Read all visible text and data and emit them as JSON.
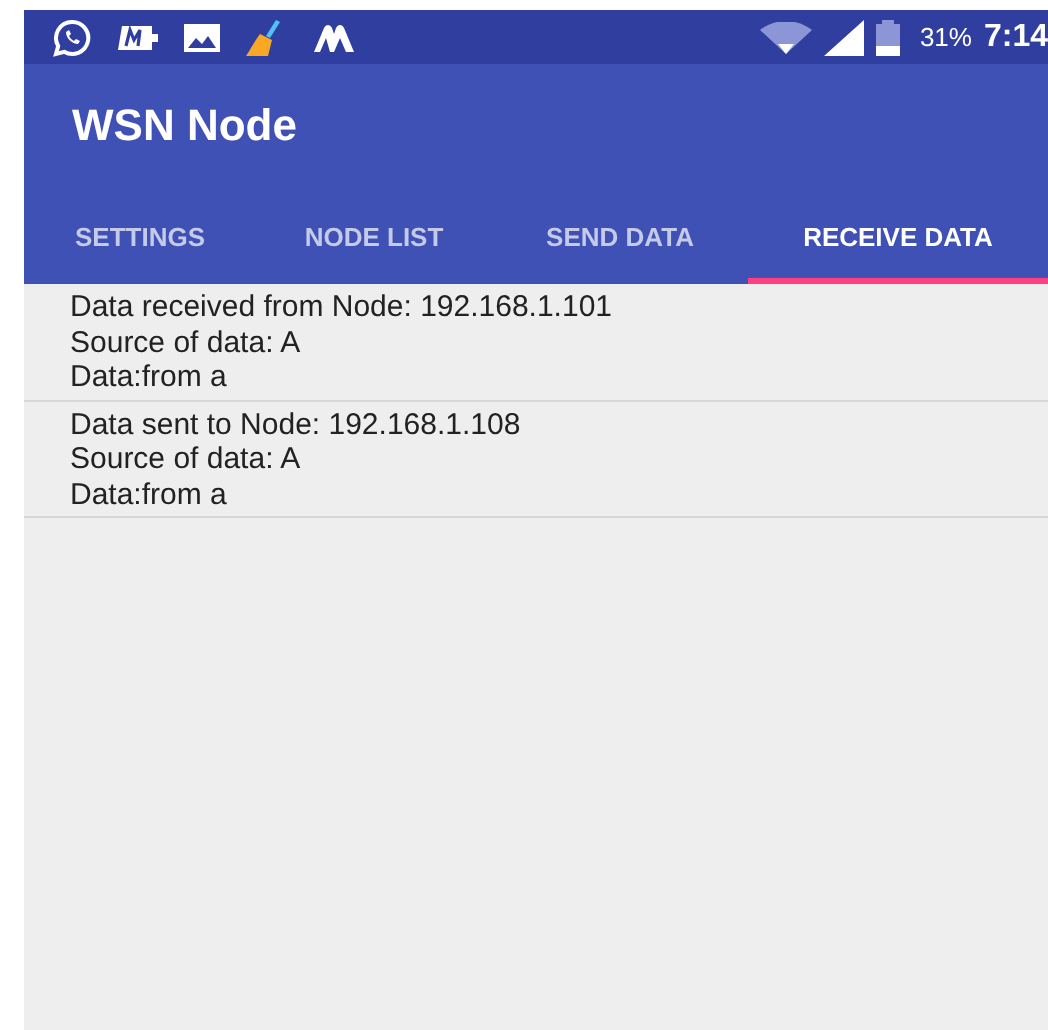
{
  "status_bar": {
    "battery": "31%",
    "time": "7:14"
  },
  "app_bar": {
    "title": "WSN Node"
  },
  "tabs": [
    {
      "label": "SETTINGS",
      "selected": false
    },
    {
      "label": "NODE LIST",
      "selected": false
    },
    {
      "label": "SEND DATA",
      "selected": false
    },
    {
      "label": "RECEIVE DATA",
      "selected": true
    }
  ],
  "messages": [
    {
      "lines": [
        "Data received from Node: 192.168.1.101",
        "Source of data: A",
        "Data:from a"
      ]
    },
    {
      "lines": [
        "Data sent to Node: 192.168.1.108",
        "Source of data: A",
        "Data:from a"
      ]
    }
  ]
}
